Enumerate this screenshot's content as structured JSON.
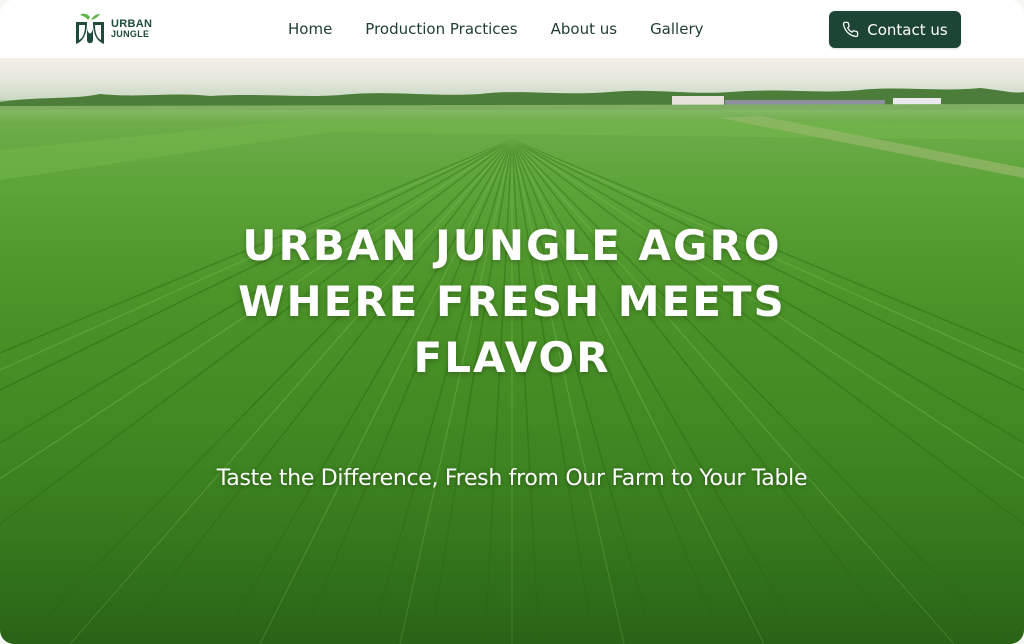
{
  "brand": {
    "name_line1": "URBAN",
    "name_line2": "JUNGLE",
    "logo_icon": "leaf-shield-icon"
  },
  "nav": {
    "items": [
      {
        "label": "Home"
      },
      {
        "label": "Production Practices"
      },
      {
        "label": "About us"
      },
      {
        "label": "Gallery"
      }
    ]
  },
  "header": {
    "contact_label": "Contact us",
    "contact_icon": "phone-icon"
  },
  "hero": {
    "title_line1": "Urban Jungle Agro",
    "title_line2": "Where fresh meets",
    "title_line3": "flavor",
    "subtitle": "Taste the Difference, Fresh from Our Farm to Your Table",
    "background": "green-crop-field-photo"
  },
  "colors": {
    "brand_dark_green": "#1d4535",
    "accent_green": "#5fb648",
    "text_dark": "#1f3d32"
  }
}
